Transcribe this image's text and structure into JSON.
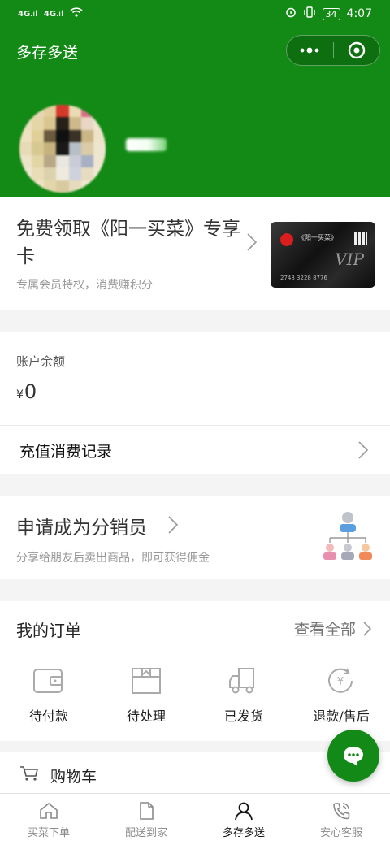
{
  "status_bar": {
    "network_1": "4G",
    "network_2": "4G",
    "battery": "34",
    "time": "4:07"
  },
  "header": {
    "app_title": "多存多送",
    "bg_color": "#128a15"
  },
  "promo": {
    "title": "免费领取《阳一买菜》专享卡",
    "subtitle": "专属会员特权，消费赚积分",
    "card_number": "2748 3228 8776",
    "card_mark": "VIP"
  },
  "balance": {
    "label": "账户余额",
    "currency": "¥",
    "value": "0",
    "records_label": "充值消费记录"
  },
  "distributor": {
    "title": "申请成为分销员",
    "subtitle": "分享给朋友后卖出商品，即可获得佣金"
  },
  "orders": {
    "title": "我的订单",
    "view_all": "查看全部",
    "items": [
      {
        "label": "待付款",
        "icon": "wallet-icon"
      },
      {
        "label": "待处理",
        "icon": "package-icon"
      },
      {
        "label": "已发货",
        "icon": "truck-icon"
      },
      {
        "label": "退款/售后",
        "icon": "refund-icon"
      }
    ]
  },
  "cart": {
    "label": "购物车",
    "icon": "cart-icon"
  },
  "fab": {
    "icon": "chat-bubble-icon",
    "color": "#138a17"
  },
  "tabbar": {
    "tabs": [
      {
        "label": "买菜下单",
        "icon": "home-icon",
        "active": false
      },
      {
        "label": "配送到家",
        "icon": "document-icon",
        "active": false
      },
      {
        "label": "多存多送",
        "icon": "user-icon",
        "active": true
      },
      {
        "label": "安心客服",
        "icon": "phone-icon",
        "active": false
      }
    ]
  }
}
